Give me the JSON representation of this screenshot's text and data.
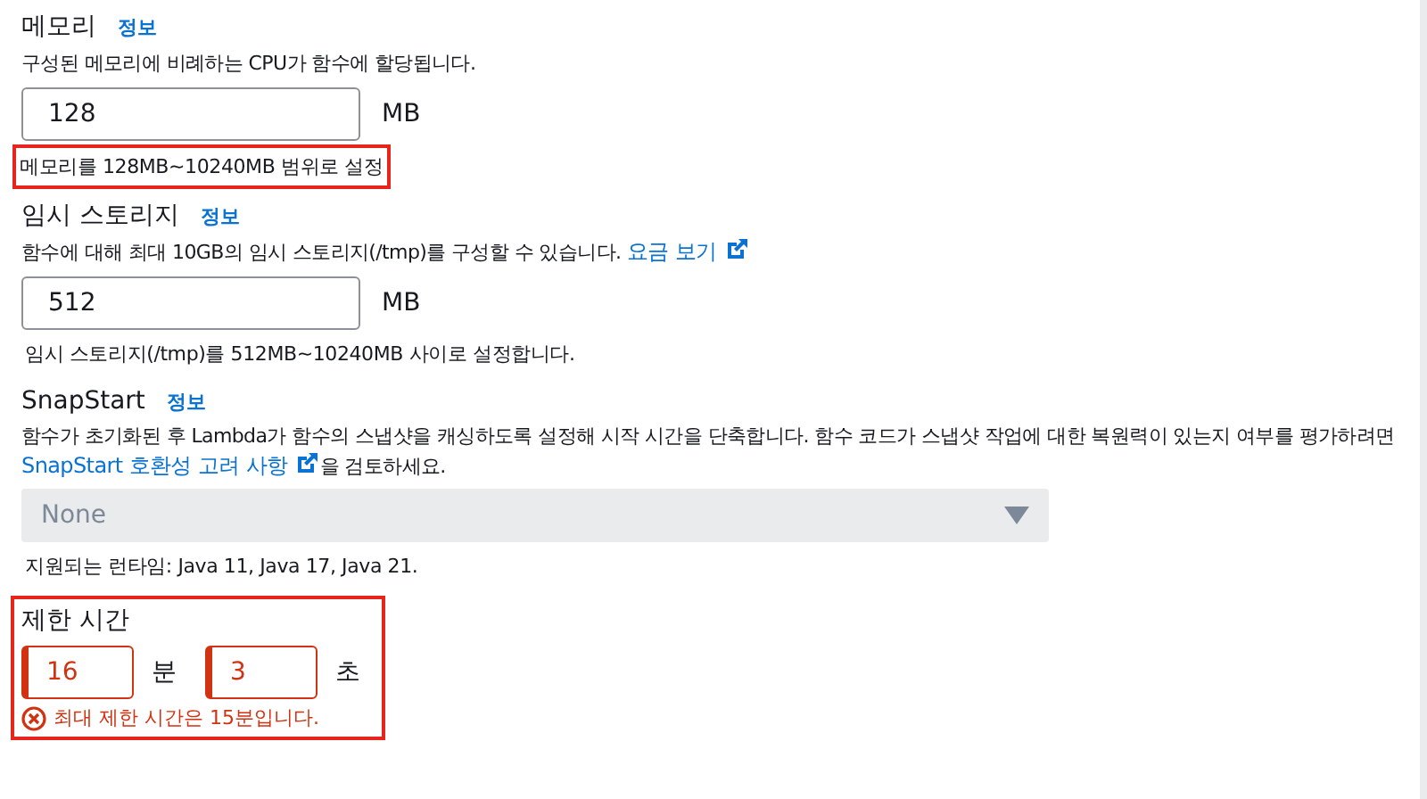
{
  "sections": [
    {
      "kind": "number",
      "label": "메모리",
      "info": "정보",
      "description": "구성된 메모리에 비례하는 CPU가 함수에 할당됩니다.",
      "value": "128",
      "unit": "MB",
      "hint": "메모리를 128MB~10240MB 범위로 설정",
      "hint_highlighted": true
    },
    {
      "kind": "number",
      "label": "임시 스토리지",
      "info": "정보",
      "description": "함수에 대해 최대 10GB의 임시 스토리지(/tmp)를 구성할 수 있습니다.",
      "link": "요금 보기",
      "value": "512",
      "unit": "MB",
      "hint": "임시 스토리지(/tmp)를 512MB~10240MB 사이로 설정합니다.",
      "hint_highlighted": false
    },
    {
      "kind": "select",
      "label": "SnapStart",
      "info": "정보",
      "description": "함수가 초기화된 후 Lambda가 함수의 스냅샷을 캐싱하도록 설정해 시작 시간을 단축합니다. 함수 코드가 스냅샷 작업에 대한 복원력이 있는지 여부를 평가하려면",
      "link": "SnapStart 호환성 고려 사항",
      "description_after": "을 검토하세요.",
      "value": "None",
      "disabled": true,
      "hint": "지원되는 런타임: Java 11, Java 17, Java 21."
    },
    {
      "kind": "duration",
      "label": "제한 시간",
      "highlighted": true,
      "fields": [
        {
          "value": "16",
          "unit": "분",
          "invalid": true
        },
        {
          "value": "3",
          "unit": "초",
          "invalid": true
        }
      ],
      "error": "최대 제한 시간은 15분입니다."
    }
  ]
}
